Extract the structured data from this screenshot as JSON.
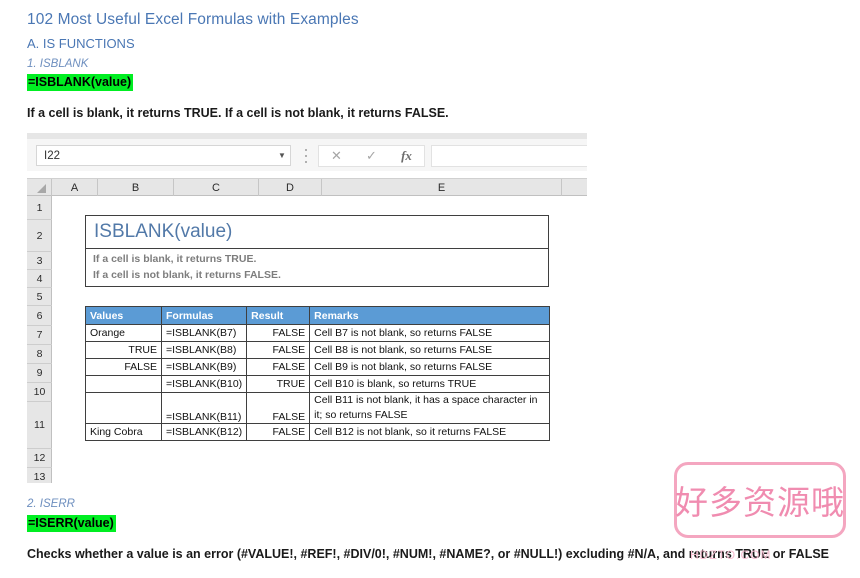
{
  "article": {
    "title": "102 Most Useful Excel Formulas with Examples",
    "section": "A. IS FUNCTIONS",
    "fn1": {
      "label": "1. ISBLANK",
      "syntax": "=ISBLANK(value)",
      "description": "If a cell is blank, it returns TRUE. If a cell is not blank, it returns FALSE."
    },
    "fn2": {
      "label": "2. ISERR",
      "syntax": "=ISERR(value)",
      "description": "Checks whether a value is an error (#VALUE!, #REF!, #DIV/0!, #NUM!, #NAME?, or #NULL!) excluding #N/A, and returns TRUE or FALSE"
    }
  },
  "excel": {
    "name_box": {
      "value": "I22",
      "dropdown_icon": "chevron-down-icon"
    },
    "formula_bar": {
      "cancel_icon": "close-icon",
      "confirm_icon": "check-icon",
      "function_icon": "fx-icon",
      "value": ""
    },
    "columns": [
      "A",
      "B",
      "C",
      "D",
      "E"
    ],
    "rows": [
      "1",
      "2",
      "3",
      "4",
      "5",
      "6",
      "7",
      "8",
      "9",
      "10",
      "11",
      "12",
      "13"
    ],
    "card": {
      "title": "ISBLANK(value)",
      "lines": [
        "If a cell is blank, it returns TRUE.",
        "If a cell is not blank, it returns FALSE."
      ]
    },
    "table": {
      "headers": [
        "Values",
        "Formulas",
        "Result",
        "Remarks"
      ],
      "rows": [
        {
          "values": "Orange",
          "values_align": "left",
          "formulas": "=ISBLANK(B7)",
          "result": "FALSE",
          "remarks": "Cell B7 is not blank, so returns FALSE",
          "tall": false
        },
        {
          "values": "TRUE",
          "values_align": "right",
          "formulas": "=ISBLANK(B8)",
          "result": "FALSE",
          "remarks": "Cell B8 is not blank, so returns FALSE",
          "tall": false
        },
        {
          "values": "FALSE",
          "values_align": "right",
          "formulas": "=ISBLANK(B9)",
          "result": "FALSE",
          "remarks": "Cell B9 is not blank, so returns FALSE",
          "tall": false
        },
        {
          "values": "",
          "values_align": "left",
          "formulas": "=ISBLANK(B10)",
          "result": "TRUE",
          "remarks": "Cell B10 is blank, so returns TRUE",
          "tall": false
        },
        {
          "values": "",
          "values_align": "left",
          "formulas": "=ISBLANK(B11)",
          "result": "FALSE",
          "remarks": "Cell B11 is not blank, it has a space character in it; so returns FALSE",
          "tall": true
        },
        {
          "values": "King Cobra",
          "values_align": "left",
          "formulas": "=ISBLANK(B12)",
          "result": "FALSE",
          "remarks": "Cell B12 is not blank, so it returns FALSE",
          "tall": false
        }
      ]
    }
  },
  "watermark": {
    "text": "好多资源哦",
    "subtext": "HDZTO.COM"
  },
  "colors": {
    "heading_blue": "#4a77b4",
    "highlight_green": "#00ee22",
    "table_header_blue": "#5b9bd5",
    "watermark_pink": "#f08cb0"
  }
}
